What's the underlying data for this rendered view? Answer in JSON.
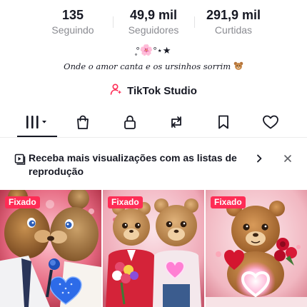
{
  "stats": [
    {
      "value": "135",
      "label": "Seguindo"
    },
    {
      "value": "49,9 mil",
      "label": "Seguidores"
    },
    {
      "value": "291,9 mil",
      "label": "Curtidas"
    }
  ],
  "bio": {
    "line1_left": "̥°",
    "line1_flower": "🌸",
    "line1_right": "°⋆★",
    "line2": "Onde o amor canta e os ursinhos sorrim"
  },
  "studio": {
    "label": "TikTok Studio"
  },
  "tabs": [
    {
      "icon": "videos-grid-icon"
    },
    {
      "icon": "shop-bag-icon"
    },
    {
      "icon": "lock-icon"
    },
    {
      "icon": "repost-icon"
    },
    {
      "icon": "bookmark-icon"
    },
    {
      "icon": "heart-icon"
    }
  ],
  "banner": {
    "text": "Receba mais visualizações com as listas de reprodução"
  },
  "videos": [
    {
      "badge": "Fixado"
    },
    {
      "badge": "Fixado"
    },
    {
      "badge": "Fixado"
    }
  ],
  "colors": {
    "accent": "#fe2c55",
    "text": "#161823",
    "muted": "#8a8b91"
  }
}
